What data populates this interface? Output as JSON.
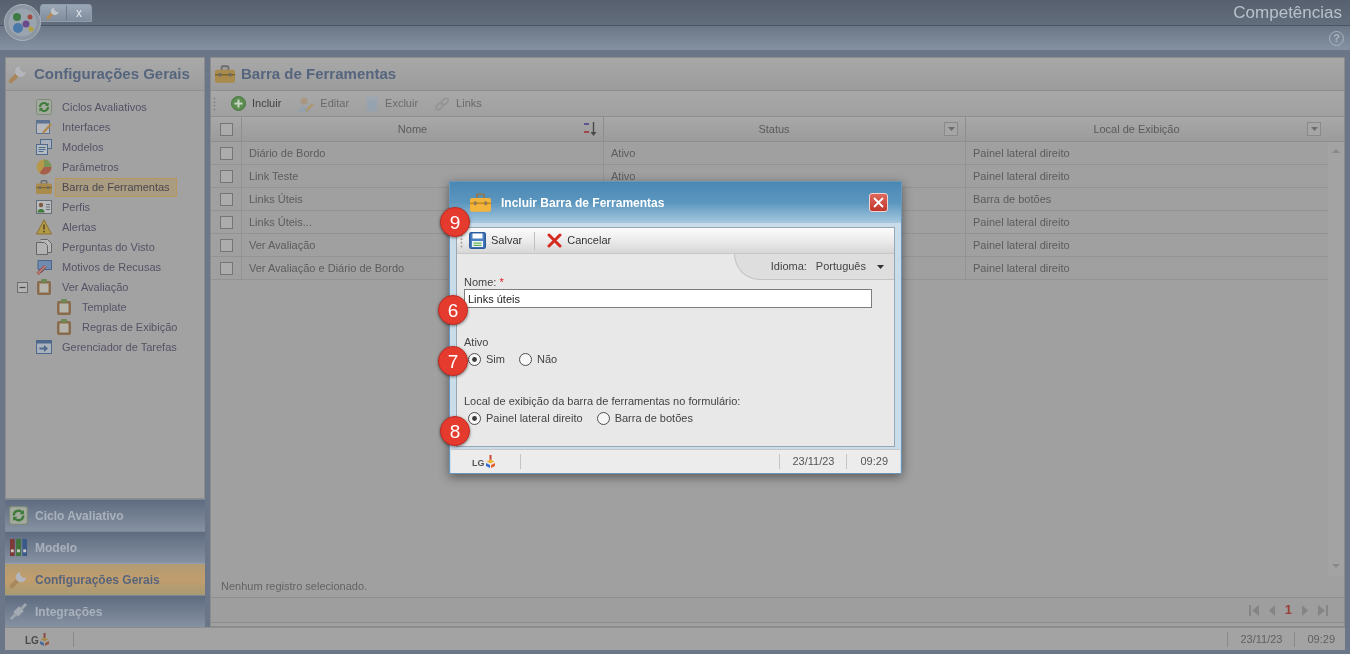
{
  "app": {
    "title": "Competências",
    "help": "?",
    "tab_close": "x"
  },
  "sidebar": {
    "title": "Configurações Gerais",
    "items": [
      {
        "label": "Ciclos Avaliativos",
        "selected": false
      },
      {
        "label": "Interfaces",
        "selected": false
      },
      {
        "label": "Modelos",
        "selected": false
      },
      {
        "label": "Parâmetros",
        "selected": false
      },
      {
        "label": "Barra de Ferramentas",
        "selected": true
      },
      {
        "label": "Perfis",
        "selected": false
      },
      {
        "label": "Alertas",
        "selected": false
      },
      {
        "label": "Perguntas do Visto",
        "selected": false
      },
      {
        "label": "Motivos de Recusas",
        "selected": false
      },
      {
        "label": "Ver Avaliação",
        "selected": false,
        "expanded": true,
        "children": [
          {
            "label": "Template",
            "selected": false
          },
          {
            "label": "Regras de Exibição",
            "selected": false
          }
        ]
      },
      {
        "label": "Gerenciador de Tarefas",
        "selected": false
      }
    ]
  },
  "modules": [
    {
      "label": "Ciclo Avaliativo",
      "selected": false
    },
    {
      "label": "Modelo",
      "selected": false
    },
    {
      "label": "Configurações Gerais",
      "selected": true
    },
    {
      "label": "Integrações",
      "selected": false
    }
  ],
  "main": {
    "title": "Barra de Ferramentas",
    "toolbar": [
      {
        "label": "Incluir",
        "disabled": false
      },
      {
        "label": "Editar",
        "disabled": true
      },
      {
        "label": "Excluir",
        "disabled": true
      },
      {
        "label": "Links",
        "disabled": true
      }
    ],
    "table": {
      "all_checked": false,
      "columns": [
        {
          "label": "Nome",
          "kind": "sort"
        },
        {
          "label": "Status",
          "kind": "filter"
        },
        {
          "label": "Local de Exibição",
          "kind": "filter"
        }
      ],
      "rows": [
        {
          "checked": false,
          "name": "Diário de Bordo",
          "status": "Ativo",
          "location": "Painel lateral direito"
        },
        {
          "checked": false,
          "name": "Link Teste",
          "status": "Ativo",
          "location": "Painel lateral direito"
        },
        {
          "checked": false,
          "name": "Links Úteis",
          "location": "Barra de botões"
        },
        {
          "checked": false,
          "name": "Links Úteis...",
          "location": "Painel lateral direito"
        },
        {
          "checked": false,
          "name": "Ver Avaliação",
          "location": "Painel lateral direito"
        },
        {
          "checked": false,
          "name": "Ver Avaliação e Diário de Bordo",
          "location": "Painel lateral direito"
        }
      ]
    },
    "message": "Nenhum registro selecionado.",
    "pager": {
      "page": "1"
    }
  },
  "status_bar": {
    "logo": "LG",
    "date": "23/11/23",
    "time": "09:29"
  },
  "dialog": {
    "title": "Incluir Barra de Ferramentas",
    "toolbar": [
      {
        "label": "Salvar",
        "kind": "save"
      },
      {
        "label": "Cancelar",
        "kind": "cancel"
      }
    ],
    "language": {
      "label": "Idioma:",
      "value": "Português"
    },
    "fields": [
      {
        "kind": "text",
        "label": "Nome:",
        "required_mark": "*",
        "value": "Links úteis"
      },
      {
        "kind": "radio",
        "label": "Ativo",
        "options": [
          {
            "label": "Sim",
            "selected": true
          },
          {
            "label": "Não",
            "selected": false
          }
        ]
      },
      {
        "kind": "radio",
        "label": "Local de exibição da barra de ferramentas no formulário:",
        "options": [
          {
            "label": "Painel lateral direito",
            "selected": true
          },
          {
            "label": "Barra de botões",
            "selected": false
          }
        ]
      }
    ],
    "status_bar": {
      "logo": "LG",
      "date": "23/11/23",
      "time": "09:29"
    }
  },
  "annotations": [
    {
      "label": "9"
    },
    {
      "label": "6"
    },
    {
      "label": "7"
    },
    {
      "label": "8"
    }
  ]
}
